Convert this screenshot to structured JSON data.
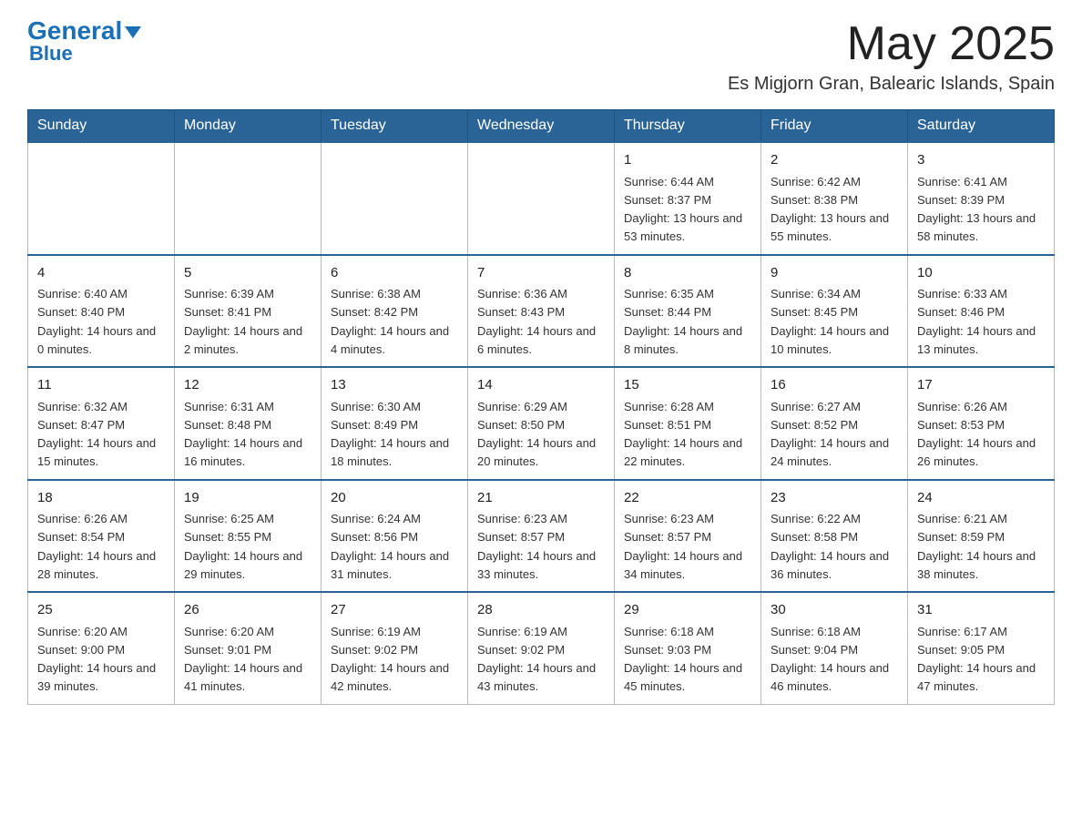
{
  "header": {
    "logo_general": "General",
    "logo_blue": "Blue",
    "month_year": "May 2025",
    "location": "Es Migjorn Gran, Balearic Islands, Spain"
  },
  "weekdays": [
    "Sunday",
    "Monday",
    "Tuesday",
    "Wednesday",
    "Thursday",
    "Friday",
    "Saturday"
  ],
  "weeks": [
    [
      {
        "day": "",
        "sunrise": "",
        "sunset": "",
        "daylight": ""
      },
      {
        "day": "",
        "sunrise": "",
        "sunset": "",
        "daylight": ""
      },
      {
        "day": "",
        "sunrise": "",
        "sunset": "",
        "daylight": ""
      },
      {
        "day": "",
        "sunrise": "",
        "sunset": "",
        "daylight": ""
      },
      {
        "day": "1",
        "sunrise": "Sunrise: 6:44 AM",
        "sunset": "Sunset: 8:37 PM",
        "daylight": "Daylight: 13 hours and 53 minutes."
      },
      {
        "day": "2",
        "sunrise": "Sunrise: 6:42 AM",
        "sunset": "Sunset: 8:38 PM",
        "daylight": "Daylight: 13 hours and 55 minutes."
      },
      {
        "day": "3",
        "sunrise": "Sunrise: 6:41 AM",
        "sunset": "Sunset: 8:39 PM",
        "daylight": "Daylight: 13 hours and 58 minutes."
      }
    ],
    [
      {
        "day": "4",
        "sunrise": "Sunrise: 6:40 AM",
        "sunset": "Sunset: 8:40 PM",
        "daylight": "Daylight: 14 hours and 0 minutes."
      },
      {
        "day": "5",
        "sunrise": "Sunrise: 6:39 AM",
        "sunset": "Sunset: 8:41 PM",
        "daylight": "Daylight: 14 hours and 2 minutes."
      },
      {
        "day": "6",
        "sunrise": "Sunrise: 6:38 AM",
        "sunset": "Sunset: 8:42 PM",
        "daylight": "Daylight: 14 hours and 4 minutes."
      },
      {
        "day": "7",
        "sunrise": "Sunrise: 6:36 AM",
        "sunset": "Sunset: 8:43 PM",
        "daylight": "Daylight: 14 hours and 6 minutes."
      },
      {
        "day": "8",
        "sunrise": "Sunrise: 6:35 AM",
        "sunset": "Sunset: 8:44 PM",
        "daylight": "Daylight: 14 hours and 8 minutes."
      },
      {
        "day": "9",
        "sunrise": "Sunrise: 6:34 AM",
        "sunset": "Sunset: 8:45 PM",
        "daylight": "Daylight: 14 hours and 10 minutes."
      },
      {
        "day": "10",
        "sunrise": "Sunrise: 6:33 AM",
        "sunset": "Sunset: 8:46 PM",
        "daylight": "Daylight: 14 hours and 13 minutes."
      }
    ],
    [
      {
        "day": "11",
        "sunrise": "Sunrise: 6:32 AM",
        "sunset": "Sunset: 8:47 PM",
        "daylight": "Daylight: 14 hours and 15 minutes."
      },
      {
        "day": "12",
        "sunrise": "Sunrise: 6:31 AM",
        "sunset": "Sunset: 8:48 PM",
        "daylight": "Daylight: 14 hours and 16 minutes."
      },
      {
        "day": "13",
        "sunrise": "Sunrise: 6:30 AM",
        "sunset": "Sunset: 8:49 PM",
        "daylight": "Daylight: 14 hours and 18 minutes."
      },
      {
        "day": "14",
        "sunrise": "Sunrise: 6:29 AM",
        "sunset": "Sunset: 8:50 PM",
        "daylight": "Daylight: 14 hours and 20 minutes."
      },
      {
        "day": "15",
        "sunrise": "Sunrise: 6:28 AM",
        "sunset": "Sunset: 8:51 PM",
        "daylight": "Daylight: 14 hours and 22 minutes."
      },
      {
        "day": "16",
        "sunrise": "Sunrise: 6:27 AM",
        "sunset": "Sunset: 8:52 PM",
        "daylight": "Daylight: 14 hours and 24 minutes."
      },
      {
        "day": "17",
        "sunrise": "Sunrise: 6:26 AM",
        "sunset": "Sunset: 8:53 PM",
        "daylight": "Daylight: 14 hours and 26 minutes."
      }
    ],
    [
      {
        "day": "18",
        "sunrise": "Sunrise: 6:26 AM",
        "sunset": "Sunset: 8:54 PM",
        "daylight": "Daylight: 14 hours and 28 minutes."
      },
      {
        "day": "19",
        "sunrise": "Sunrise: 6:25 AM",
        "sunset": "Sunset: 8:55 PM",
        "daylight": "Daylight: 14 hours and 29 minutes."
      },
      {
        "day": "20",
        "sunrise": "Sunrise: 6:24 AM",
        "sunset": "Sunset: 8:56 PM",
        "daylight": "Daylight: 14 hours and 31 minutes."
      },
      {
        "day": "21",
        "sunrise": "Sunrise: 6:23 AM",
        "sunset": "Sunset: 8:57 PM",
        "daylight": "Daylight: 14 hours and 33 minutes."
      },
      {
        "day": "22",
        "sunrise": "Sunrise: 6:23 AM",
        "sunset": "Sunset: 8:57 PM",
        "daylight": "Daylight: 14 hours and 34 minutes."
      },
      {
        "day": "23",
        "sunrise": "Sunrise: 6:22 AM",
        "sunset": "Sunset: 8:58 PM",
        "daylight": "Daylight: 14 hours and 36 minutes."
      },
      {
        "day": "24",
        "sunrise": "Sunrise: 6:21 AM",
        "sunset": "Sunset: 8:59 PM",
        "daylight": "Daylight: 14 hours and 38 minutes."
      }
    ],
    [
      {
        "day": "25",
        "sunrise": "Sunrise: 6:20 AM",
        "sunset": "Sunset: 9:00 PM",
        "daylight": "Daylight: 14 hours and 39 minutes."
      },
      {
        "day": "26",
        "sunrise": "Sunrise: 6:20 AM",
        "sunset": "Sunset: 9:01 PM",
        "daylight": "Daylight: 14 hours and 41 minutes."
      },
      {
        "day": "27",
        "sunrise": "Sunrise: 6:19 AM",
        "sunset": "Sunset: 9:02 PM",
        "daylight": "Daylight: 14 hours and 42 minutes."
      },
      {
        "day": "28",
        "sunrise": "Sunrise: 6:19 AM",
        "sunset": "Sunset: 9:02 PM",
        "daylight": "Daylight: 14 hours and 43 minutes."
      },
      {
        "day": "29",
        "sunrise": "Sunrise: 6:18 AM",
        "sunset": "Sunset: 9:03 PM",
        "daylight": "Daylight: 14 hours and 45 minutes."
      },
      {
        "day": "30",
        "sunrise": "Sunrise: 6:18 AM",
        "sunset": "Sunset: 9:04 PM",
        "daylight": "Daylight: 14 hours and 46 minutes."
      },
      {
        "day": "31",
        "sunrise": "Sunrise: 6:17 AM",
        "sunset": "Sunset: 9:05 PM",
        "daylight": "Daylight: 14 hours and 47 minutes."
      }
    ]
  ]
}
